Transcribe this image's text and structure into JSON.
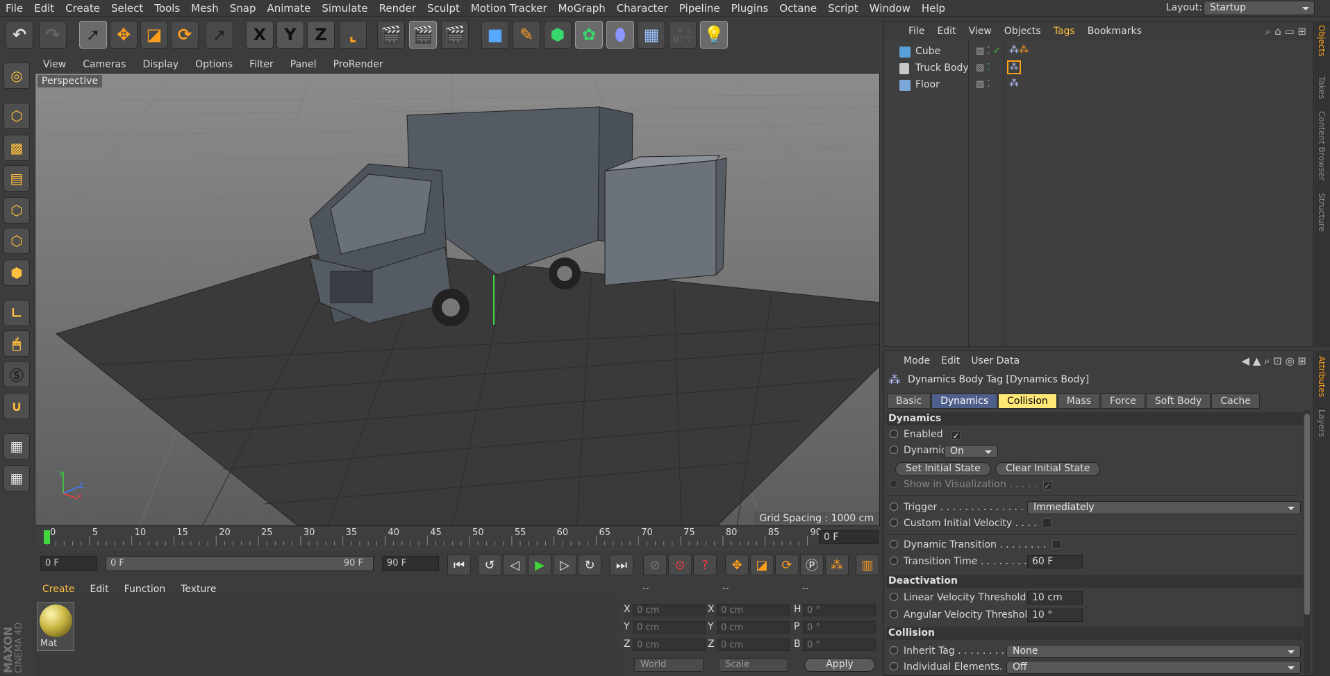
{
  "menubar": {
    "items": [
      "File",
      "Edit",
      "Create",
      "Select",
      "Tools",
      "Mesh",
      "Snap",
      "Animate",
      "Simulate",
      "Render",
      "Sculpt",
      "Motion Tracker",
      "MoGraph",
      "Character",
      "Pipeline",
      "Plugins",
      "Octane",
      "Script",
      "Window",
      "Help"
    ],
    "layout_label": "Layout:",
    "layout_value": "Startup"
  },
  "toolbar": {
    "axis_x": "X",
    "axis_y": "Y",
    "axis_z": "Z"
  },
  "viewport": {
    "menu": [
      "View",
      "Cameras",
      "Display",
      "Options",
      "Filter",
      "Panel",
      "ProRender"
    ],
    "label": "Perspective",
    "grid_spacing": "Grid Spacing : 1000 cm",
    "axis_labels": {
      "y": "Y",
      "z": "Z",
      "x": "X"
    }
  },
  "timeline": {
    "ticks": [
      "0",
      "5",
      "10",
      "15",
      "20",
      "25",
      "30",
      "35",
      "40",
      "45",
      "50",
      "55",
      "60",
      "65",
      "70",
      "75",
      "80",
      "85",
      "90"
    ],
    "current_frame": "0 F"
  },
  "transport": {
    "start_field": "0 F",
    "range_start": "0 F",
    "range_end": "90 F",
    "end_field": "90 F"
  },
  "material_manager": {
    "menu": [
      "Create",
      "Edit",
      "Function",
      "Texture"
    ],
    "materials": [
      {
        "name": "Mat"
      }
    ],
    "brand_line1": "MAXON",
    "brand_line2": "CINEMA 4D"
  },
  "coordinates": {
    "headers": [
      "--",
      "--",
      "--"
    ],
    "rows": [
      {
        "a": "X",
        "av": "0 cm",
        "b": "X",
        "bv": "0 cm",
        "c": "H",
        "cv": "0 °"
      },
      {
        "a": "Y",
        "av": "0 cm",
        "b": "Y",
        "bv": "0 cm",
        "c": "P",
        "cv": "0 °"
      },
      {
        "a": "Z",
        "av": "0 cm",
        "b": "Z",
        "bv": "0 cm",
        "c": "B",
        "cv": "0 °"
      }
    ],
    "space": "World",
    "mode": "Scale",
    "apply": "Apply"
  },
  "object_manager": {
    "menu": [
      "File",
      "Edit",
      "View",
      "Objects",
      "Tags",
      "Bookmarks"
    ],
    "objects": [
      {
        "name": "Cube",
        "color": "#5aa0d8"
      },
      {
        "name": "Truck Body",
        "color": "#c8c8c8"
      },
      {
        "name": "Floor",
        "color": "#7aa6d8"
      }
    ]
  },
  "side_tabs_top": [
    "Objects",
    "Takes",
    "Content Browser",
    "Structure"
  ],
  "side_tabs_bottom": [
    "Attributes",
    "Layers"
  ],
  "attributes": {
    "menu": [
      "Mode",
      "Edit",
      "User Data"
    ],
    "title": "Dynamics Body Tag [Dynamics Body]",
    "tabs": [
      "Basic",
      "Dynamics",
      "Collision",
      "Mass",
      "Force",
      "Soft Body",
      "Cache"
    ],
    "sections": {
      "dynamics": "Dynamics",
      "deactivation": "Deactivation",
      "collision": "Collision"
    },
    "enabled_label": "Enabled",
    "enabled_check": "✓",
    "dynamic_label": "Dynamic",
    "dynamic_value": "On",
    "set_initial": "Set Initial State",
    "clear_initial": "Clear Initial State",
    "show_vis": "Show in Visualization . . . . .",
    "show_vis_check": "✓",
    "trigger_label": "Trigger . . . . . . . . . . . . . . . . .",
    "trigger_value": "Immediately",
    "civ_label": "Custom Initial Velocity . . . .",
    "dyn_trans_label": "Dynamic Transition . . . . . . . .",
    "trans_time_label": "Transition Time . . . . . . . . . .",
    "trans_time_value": "60 F",
    "lin_vel_label": "Linear Velocity Threshold",
    "lin_vel_value": "10 cm",
    "ang_vel_label": "Angular Velocity Threshold",
    "ang_vel_value": "10 °",
    "inherit_label": "Inherit Tag . . . . . . . . . .",
    "inherit_value": "None",
    "indiv_label": "Individual Elements. . . .",
    "indiv_value": "Off"
  },
  "colors": {
    "accent_orange": "#ff9f1c",
    "tab_active": "#ffe876",
    "tab_selected": "#4f5f8c",
    "play_green": "#3ed83e"
  }
}
